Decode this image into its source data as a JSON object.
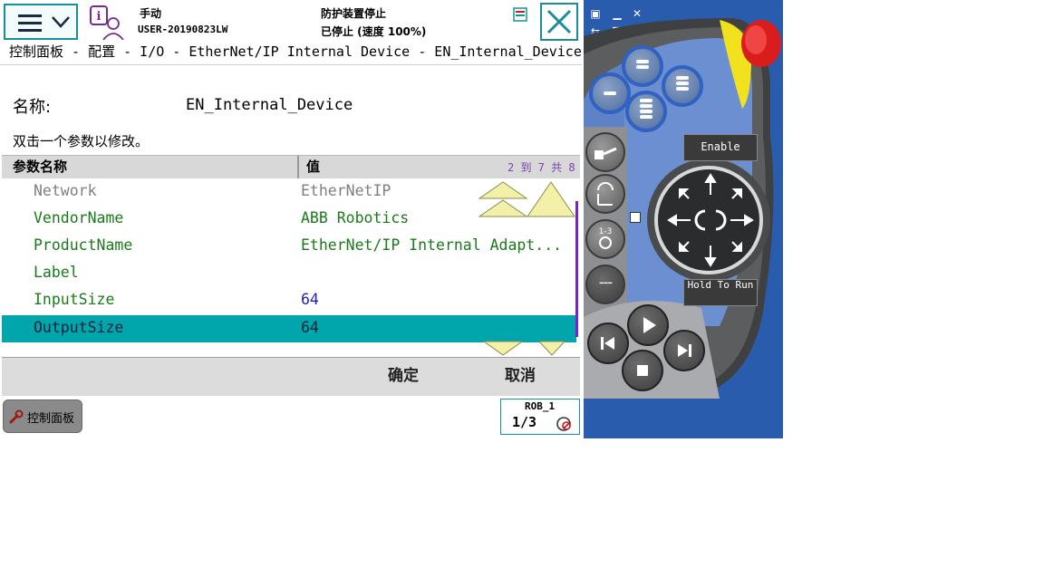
{
  "status": {
    "mode": "手动",
    "system": "USER-20190823LW",
    "safety": "防护装置停止",
    "state": "已停止 (速度 100%)"
  },
  "breadcrumb": "控制面板 - 配置 - I/O - EtherNet/IP Internal Device - EN_Internal_Device",
  "name_label": "名称:",
  "name_value": "EN_Internal_Device",
  "instruction": "双击一个参数以修改。",
  "table": {
    "col_name": "参数名称",
    "col_value": "值",
    "paging": "2 到 7 共 8",
    "rows": [
      {
        "name": "Network",
        "value": "EtherNetIP"
      },
      {
        "name": "VendorName",
        "value": "ABB Robotics"
      },
      {
        "name": "ProductName",
        "value": "EtherNet/IP Internal Adapt..."
      },
      {
        "name": "Label",
        "value": ""
      },
      {
        "name": "InputSize",
        "value": "64"
      },
      {
        "name": "OutputSize",
        "value": "64"
      }
    ]
  },
  "buttons": {
    "ok": "确定",
    "cancel": "取消"
  },
  "taskbar": {
    "control_panel": "控制面板",
    "rob": "ROB_1",
    "fraction": "1/3"
  },
  "pendant": {
    "enable": "Enable",
    "hold_to_run": "Hold To Run"
  },
  "colors": {
    "teal": "#00a6ac",
    "pendant_blue": "#2a5cad",
    "stop_red": "#e01818"
  }
}
